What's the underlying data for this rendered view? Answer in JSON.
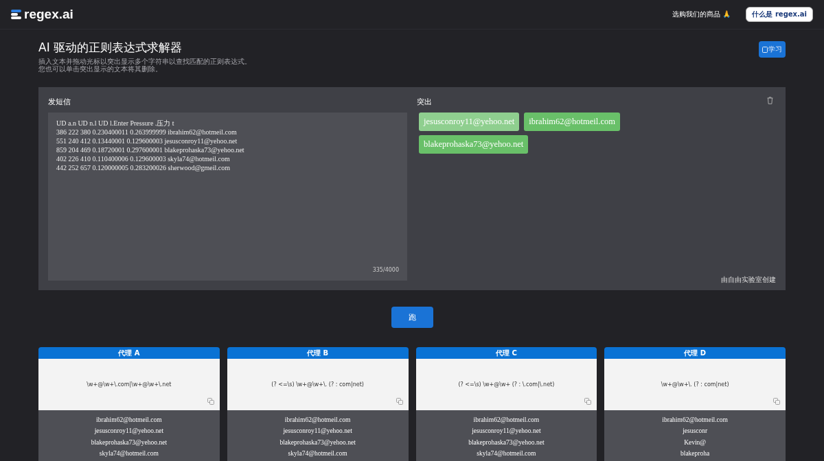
{
  "header": {
    "logo": "regex.ai",
    "shop_link": "选购我们的商品 🙏",
    "about_button": "什么是 regex.ai"
  },
  "intro": {
    "title": "AI 驱动的正则表达式求解器",
    "lines": [
      "插入文本并拖动光标以突出显示多个字符串以查找匹配的正则表达式。",
      "您也可以单击突出显示的文本将其删除。"
    ],
    "learn_button": "学习"
  },
  "input": {
    "label": "发短信",
    "lines": [
      "UD a.n UD n.l UD l.Enter Pressure .压力 t",
      "386 222 380 0.230400011 0.263999999 ibrahim62@hotmeil.com",
      "551 240 412 0.13440001 0.129600003 jesusconroy11@yehoo.net",
      "859 204 469 0.18720001 0.297600001 blakeprohaska73@yehoo.net",
      "402 226 410 0.110400006 0.129600003 skyla74@hotmeil.com",
      "442 252 657 0.120000005 0.283200026 sherwood@gmeil.com"
    ],
    "counter": "335/4000"
  },
  "highlights": {
    "label": "突出",
    "chips": [
      {
        "text": "jesusconroy11@yehoo.net",
        "selected": true
      },
      {
        "text": "ibrahim62@hotmeil.com",
        "selected": false
      },
      {
        "text": "blakeprohaska73@yehoo.net",
        "selected": false
      }
    ],
    "credit": "由自由实验室创建"
  },
  "run_button": "跑",
  "agents": [
    {
      "name": "代理 A",
      "regex": "\\w+@\\w+\\.com|\\w+@\\w+\\.net",
      "matches": [
        "ibrahim62@hotmeil.com",
        "jesusconroy11@yehoo.net",
        "blakeprohaska73@yehoo.net",
        "skyla74@hotmeil.com"
      ]
    },
    {
      "name": "代理 B",
      "regex": "(? <=\\s) \\w+@\\w+\\. (? : com|net)",
      "matches": [
        "ibrahim62@hotmeil.com",
        "jesusconroy11@yehoo.net",
        "blakeprohaska73@yehoo.net",
        "skyla74@hotmeil.com"
      ]
    },
    {
      "name": "代理 C",
      "regex": "(? <=\\s) \\w+@\\w+ (? : \\.com|\\.net)",
      "matches": [
        "ibrahim62@hotmeil.com",
        "jesusconroy11@yehoo.net",
        "blakeprohaska73@yehoo.net",
        "skyla74@hotmeil.com"
      ]
    },
    {
      "name": "代理 D",
      "regex": "\\w+@\\w+\\. (? : com|net)",
      "matches": [
        "ibrahim62@hotmeil.com",
        "jesusconr",
        "Kevin@",
        "blakeproha"
      ]
    }
  ]
}
